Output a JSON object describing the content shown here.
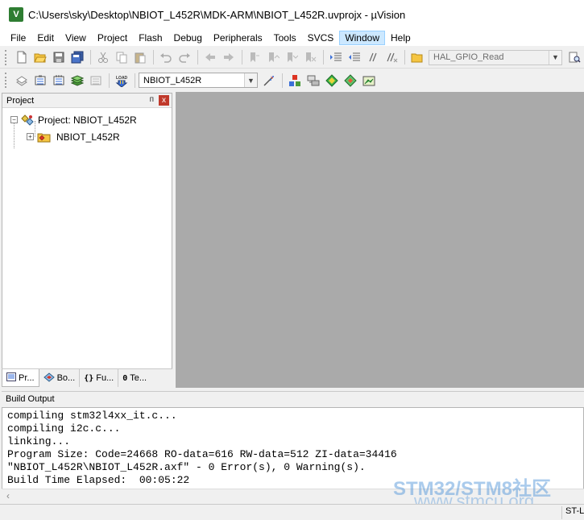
{
  "window": {
    "title": "C:\\Users\\sky\\Desktop\\NBIOT_L452R\\MDK-ARM\\NBIOT_L452R.uvprojx - µVision",
    "icon_label": "V"
  },
  "menu": [
    "File",
    "Edit",
    "View",
    "Project",
    "Flash",
    "Debug",
    "Peripherals",
    "Tools",
    "SVCS",
    "Window",
    "Help"
  ],
  "menu_active": "Window",
  "toolbar1": {
    "find_combo_value": "HAL_GPIO_Read",
    "icons": [
      "new-file-icon",
      "open-file-icon",
      "save-icon",
      "save-all-icon",
      "cut-icon",
      "copy-icon",
      "paste-icon",
      "undo-icon",
      "redo-icon",
      "nav-back-icon",
      "nav-forward-icon",
      "bookmark-icon",
      "prev-bookmark-icon",
      "next-bookmark-icon",
      "clear-bookmarks-icon",
      "indent-icon",
      "unindent-icon",
      "comment-icon",
      "uncomment-icon",
      "find-in-files-icon",
      "find-icon"
    ]
  },
  "toolbar2": {
    "target_combo_value": "NBIOT_L452R",
    "load_label": "LOAD",
    "icons": [
      "translate-icon",
      "build-icon",
      "rebuild-icon",
      "batch-build-icon",
      "stop-build-icon",
      "download-icon",
      "target-options-icon",
      "manage-components-icon",
      "pack-installer-icon",
      "select-packs-icon",
      "run-time-env-icon",
      "manage-project-icon"
    ]
  },
  "project_panel": {
    "title": "Project",
    "pin_glyph": "ᴨ",
    "close_glyph": "x",
    "root_label": "Project: NBIOT_L452R",
    "child_label": "NBIOT_L452R",
    "tabs": [
      {
        "icon": "project-tab-icon",
        "label": "Pr..."
      },
      {
        "icon": "books-tab-icon",
        "label": "Bo..."
      },
      {
        "icon": "functions-tab-icon",
        "glyph": "{}",
        "label": "Fu..."
      },
      {
        "icon": "templates-tab-icon",
        "glyph": "0",
        "label": "Te..."
      }
    ]
  },
  "build_output": {
    "title": "Build Output",
    "lines": [
      "compiling stm32l4xx_it.c...",
      "compiling i2c.c...",
      "linking...",
      "Program Size: Code=24668 RO-data=616 RW-data=512 ZI-data=34416",
      "\"NBIOT_L452R\\NBIOT_L452R.axf\" - 0 Error(s), 0 Warning(s).",
      "Build Time Elapsed:  00:05:22"
    ]
  },
  "status": {
    "right_text": "ST-Link Debugger"
  },
  "watermark": {
    "line1": "STM32/STM8社区",
    "line2": "www.stmcu.org"
  },
  "colors": {
    "editor_bg": "#aaaaaa",
    "menu_active_bg": "#cce8ff",
    "panel_close": "#c0392b",
    "watermark": "#64a0dc"
  }
}
